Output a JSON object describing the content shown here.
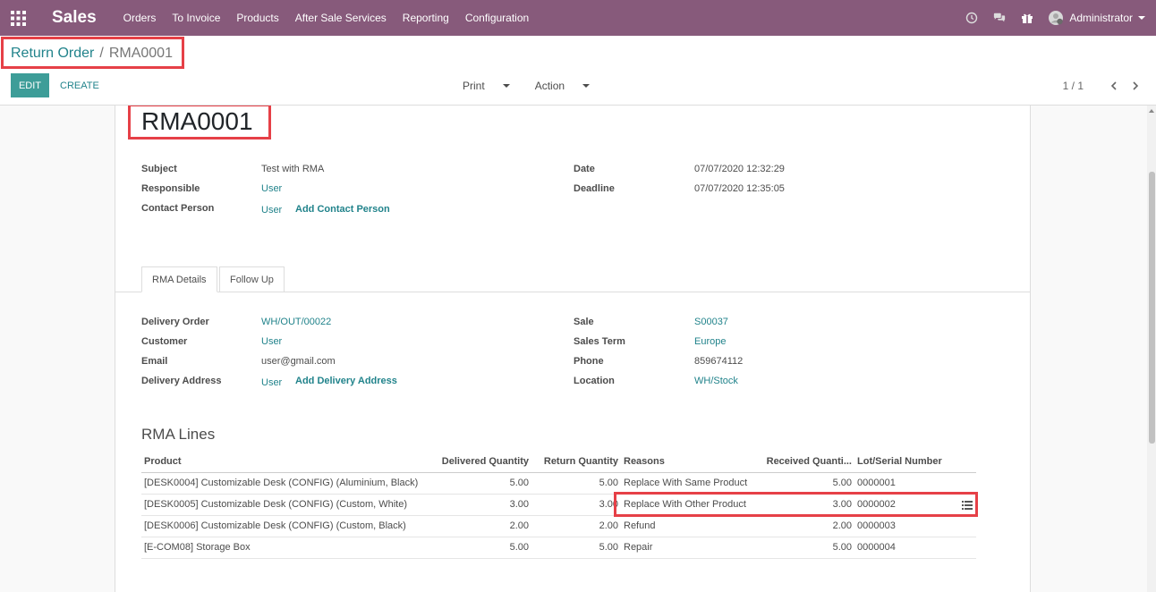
{
  "navbar": {
    "app_name": "Sales",
    "menu": [
      "Orders",
      "To Invoice",
      "Products",
      "After Sale Services",
      "Reporting",
      "Configuration"
    ],
    "user_name": "Administrator",
    "icons": [
      "apps-icon",
      "clock-icon",
      "chat-icon",
      "gift-icon",
      "user-avatar"
    ]
  },
  "breadcrumb": {
    "parent": "Return Order",
    "separator": "/",
    "current": "RMA0001"
  },
  "buttons": {
    "edit": "EDIT",
    "create": "CREATE",
    "print": "Print",
    "action": "Action"
  },
  "pager": {
    "value": "1 / 1"
  },
  "record": {
    "name": "RMA0001",
    "subject_label": "Subject",
    "subject": "Test with RMA",
    "responsible_label": "Responsible",
    "responsible": "User",
    "contact_label": "Contact Person",
    "contact": "User",
    "add_contact": "Add Contact Person",
    "date_label": "Date",
    "date": "07/07/2020 12:32:29",
    "deadline_label": "Deadline",
    "deadline": "07/07/2020 12:35:05"
  },
  "tabs": {
    "rma_details": "RMA Details",
    "follow_up": "Follow Up"
  },
  "details": {
    "delivery_order_label": "Delivery Order",
    "delivery_order": "WH/OUT/00022",
    "customer_label": "Customer",
    "customer": "User",
    "email_label": "Email",
    "email": "user@gmail.com",
    "delivery_address_label": "Delivery Address",
    "delivery_address": "User",
    "add_delivery_address": "Add Delivery Address",
    "sale_label": "Sale",
    "sale": "S00037",
    "sales_term_label": "Sales Term",
    "sales_term": "Europe",
    "phone_label": "Phone",
    "phone": "859674112",
    "location_label": "Location",
    "location": "WH/Stock"
  },
  "rma_lines": {
    "title": "RMA Lines",
    "columns": [
      "Product",
      "Delivered Quantity",
      "Return Quantity",
      "Reasons",
      "Received Quanti...",
      "Lot/Serial Number"
    ],
    "rows": [
      {
        "product": "[DESK0004] Customizable Desk (CONFIG) (Aluminium, Black)",
        "delivered": "5.00",
        "returned": "5.00",
        "reason": "Replace With Same Product",
        "received": "5.00",
        "lot": "0000001"
      },
      {
        "product": "[DESK0005] Customizable Desk (CONFIG) (Custom, White)",
        "delivered": "3.00",
        "returned": "3.00",
        "reason": "Replace With Other Product",
        "received": "3.00",
        "lot": "0000002"
      },
      {
        "product": "[DESK0006] Customizable Desk (CONFIG) (Custom, Black)",
        "delivered": "2.00",
        "returned": "2.00",
        "reason": "Refund",
        "received": "2.00",
        "lot": "0000003"
      },
      {
        "product": "[E-COM08] Storage Box",
        "delivered": "5.00",
        "returned": "5.00",
        "reason": "Repair",
        "received": "5.00",
        "lot": "0000004"
      }
    ]
  },
  "colors": {
    "navbar": "#875a7b",
    "primary": "#3d9d98",
    "link": "#21838b",
    "highlight": "#e64047"
  }
}
